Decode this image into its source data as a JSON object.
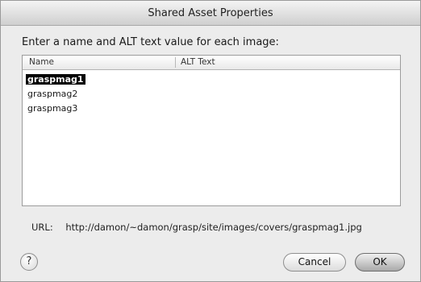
{
  "window": {
    "title": "Shared Asset Properties"
  },
  "prompt": "Enter a name and ALT text value for each image:",
  "table": {
    "columns": [
      "Name",
      "ALT Text"
    ],
    "rows": [
      {
        "name": "graspmag1",
        "alt": ""
      },
      {
        "name": "graspmag2",
        "alt": ""
      },
      {
        "name": "graspmag3",
        "alt": ""
      }
    ],
    "selected_index": 0
  },
  "url": {
    "label": "URL:",
    "value": "http://damon/~damon/grasp/site/images/covers/graspmag1.jpg"
  },
  "buttons": {
    "help": "?",
    "cancel": "Cancel",
    "ok": "OK"
  }
}
